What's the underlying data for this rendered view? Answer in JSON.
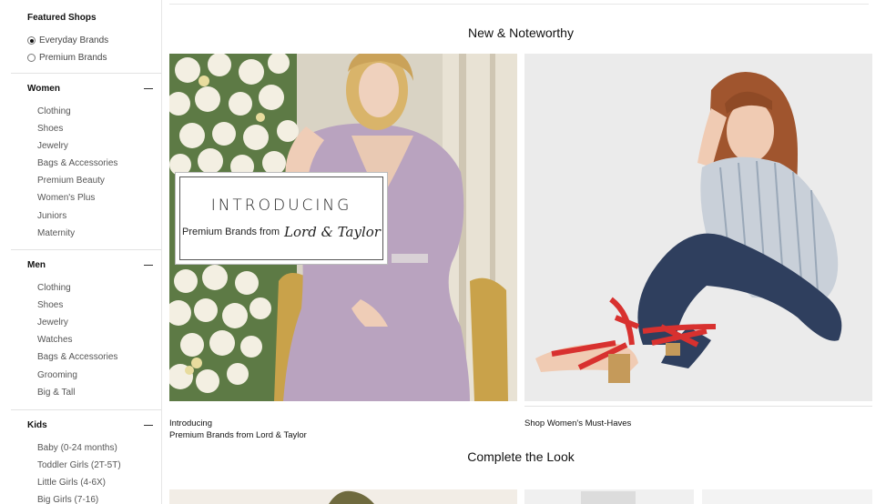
{
  "sidebar": {
    "featured": {
      "title": "Featured Shops",
      "options": [
        {
          "label": "Everyday Brands",
          "checked": true
        },
        {
          "label": "Premium Brands",
          "checked": false
        }
      ]
    },
    "women": {
      "title": "Women",
      "items": [
        "Clothing",
        "Shoes",
        "Jewelry",
        "Bags & Accessories",
        "Premium Beauty",
        "Women's Plus",
        "Juniors",
        "Maternity"
      ]
    },
    "men": {
      "title": "Men",
      "items": [
        "Clothing",
        "Shoes",
        "Jewelry",
        "Watches",
        "Bags & Accessories",
        "Grooming",
        "Big & Tall"
      ]
    },
    "kids": {
      "title": "Kids",
      "items": [
        "Baby (0-24 months)",
        "Toddler Girls (2T-5T)",
        "Little Girls (4-6X)",
        "Big Girls (7-16)"
      ]
    }
  },
  "main": {
    "new_noteworthy": "New & Noteworthy",
    "promo_left": {
      "overlay_line1": "INTRODUCING",
      "overlay_line2_prefix": "Premium Brands from",
      "overlay_brand": "Lord & Taylor",
      "caption_line1": "Introducing",
      "caption_line2": "Premium Brands from Lord & Taylor"
    },
    "promo_right": {
      "caption": "Shop Women's Must-Haves"
    },
    "complete_the_look": "Complete the Look"
  },
  "colors": {
    "accent_red": "#d8312f",
    "dress": "#b49ab8",
    "denim": "#2f3f5e"
  }
}
